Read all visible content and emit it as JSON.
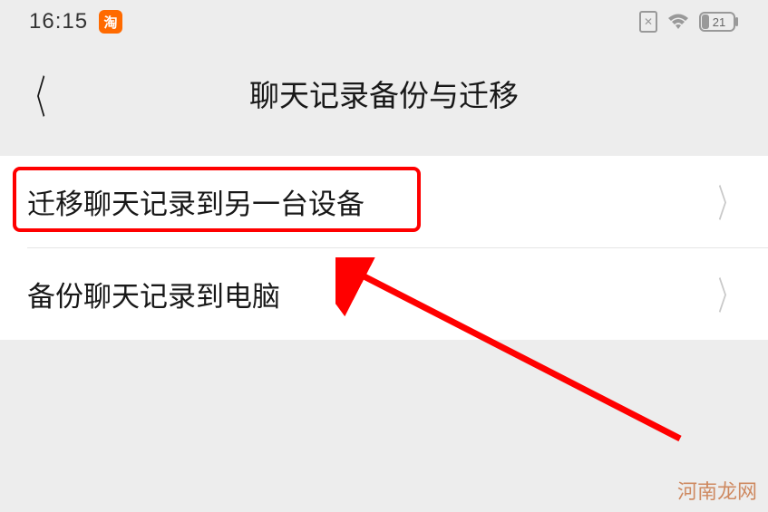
{
  "status": {
    "time": "16:15",
    "taobao_label": "淘",
    "sim_label": "✕",
    "battery": "21"
  },
  "header": {
    "title": "聊天记录备份与迁移"
  },
  "list": {
    "items": [
      {
        "label": "迁移聊天记录到另一台设备"
      },
      {
        "label": "备份聊天记录到电脑"
      }
    ]
  },
  "watermark": "河南龙网"
}
